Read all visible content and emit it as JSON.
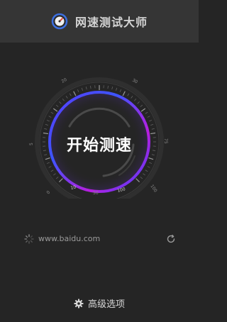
{
  "header": {
    "title": "网速测试大师",
    "logo_icon": "speedometer-logo-icon"
  },
  "gauge": {
    "tick_labels": [
      "0",
      "5",
      "10",
      "20",
      "30",
      "50",
      "75",
      "100"
    ],
    "ring_colors": {
      "accent_blue": "#3a46ff",
      "accent_magenta": "#e31cd8"
    },
    "start_label": "开始测速"
  },
  "server": {
    "icon": "loading-spinner-icon",
    "text": "www.baidu.com",
    "refresh_icon": "refresh-icon"
  },
  "advanced": {
    "icon": "gear-icon",
    "label": "高级选项"
  }
}
